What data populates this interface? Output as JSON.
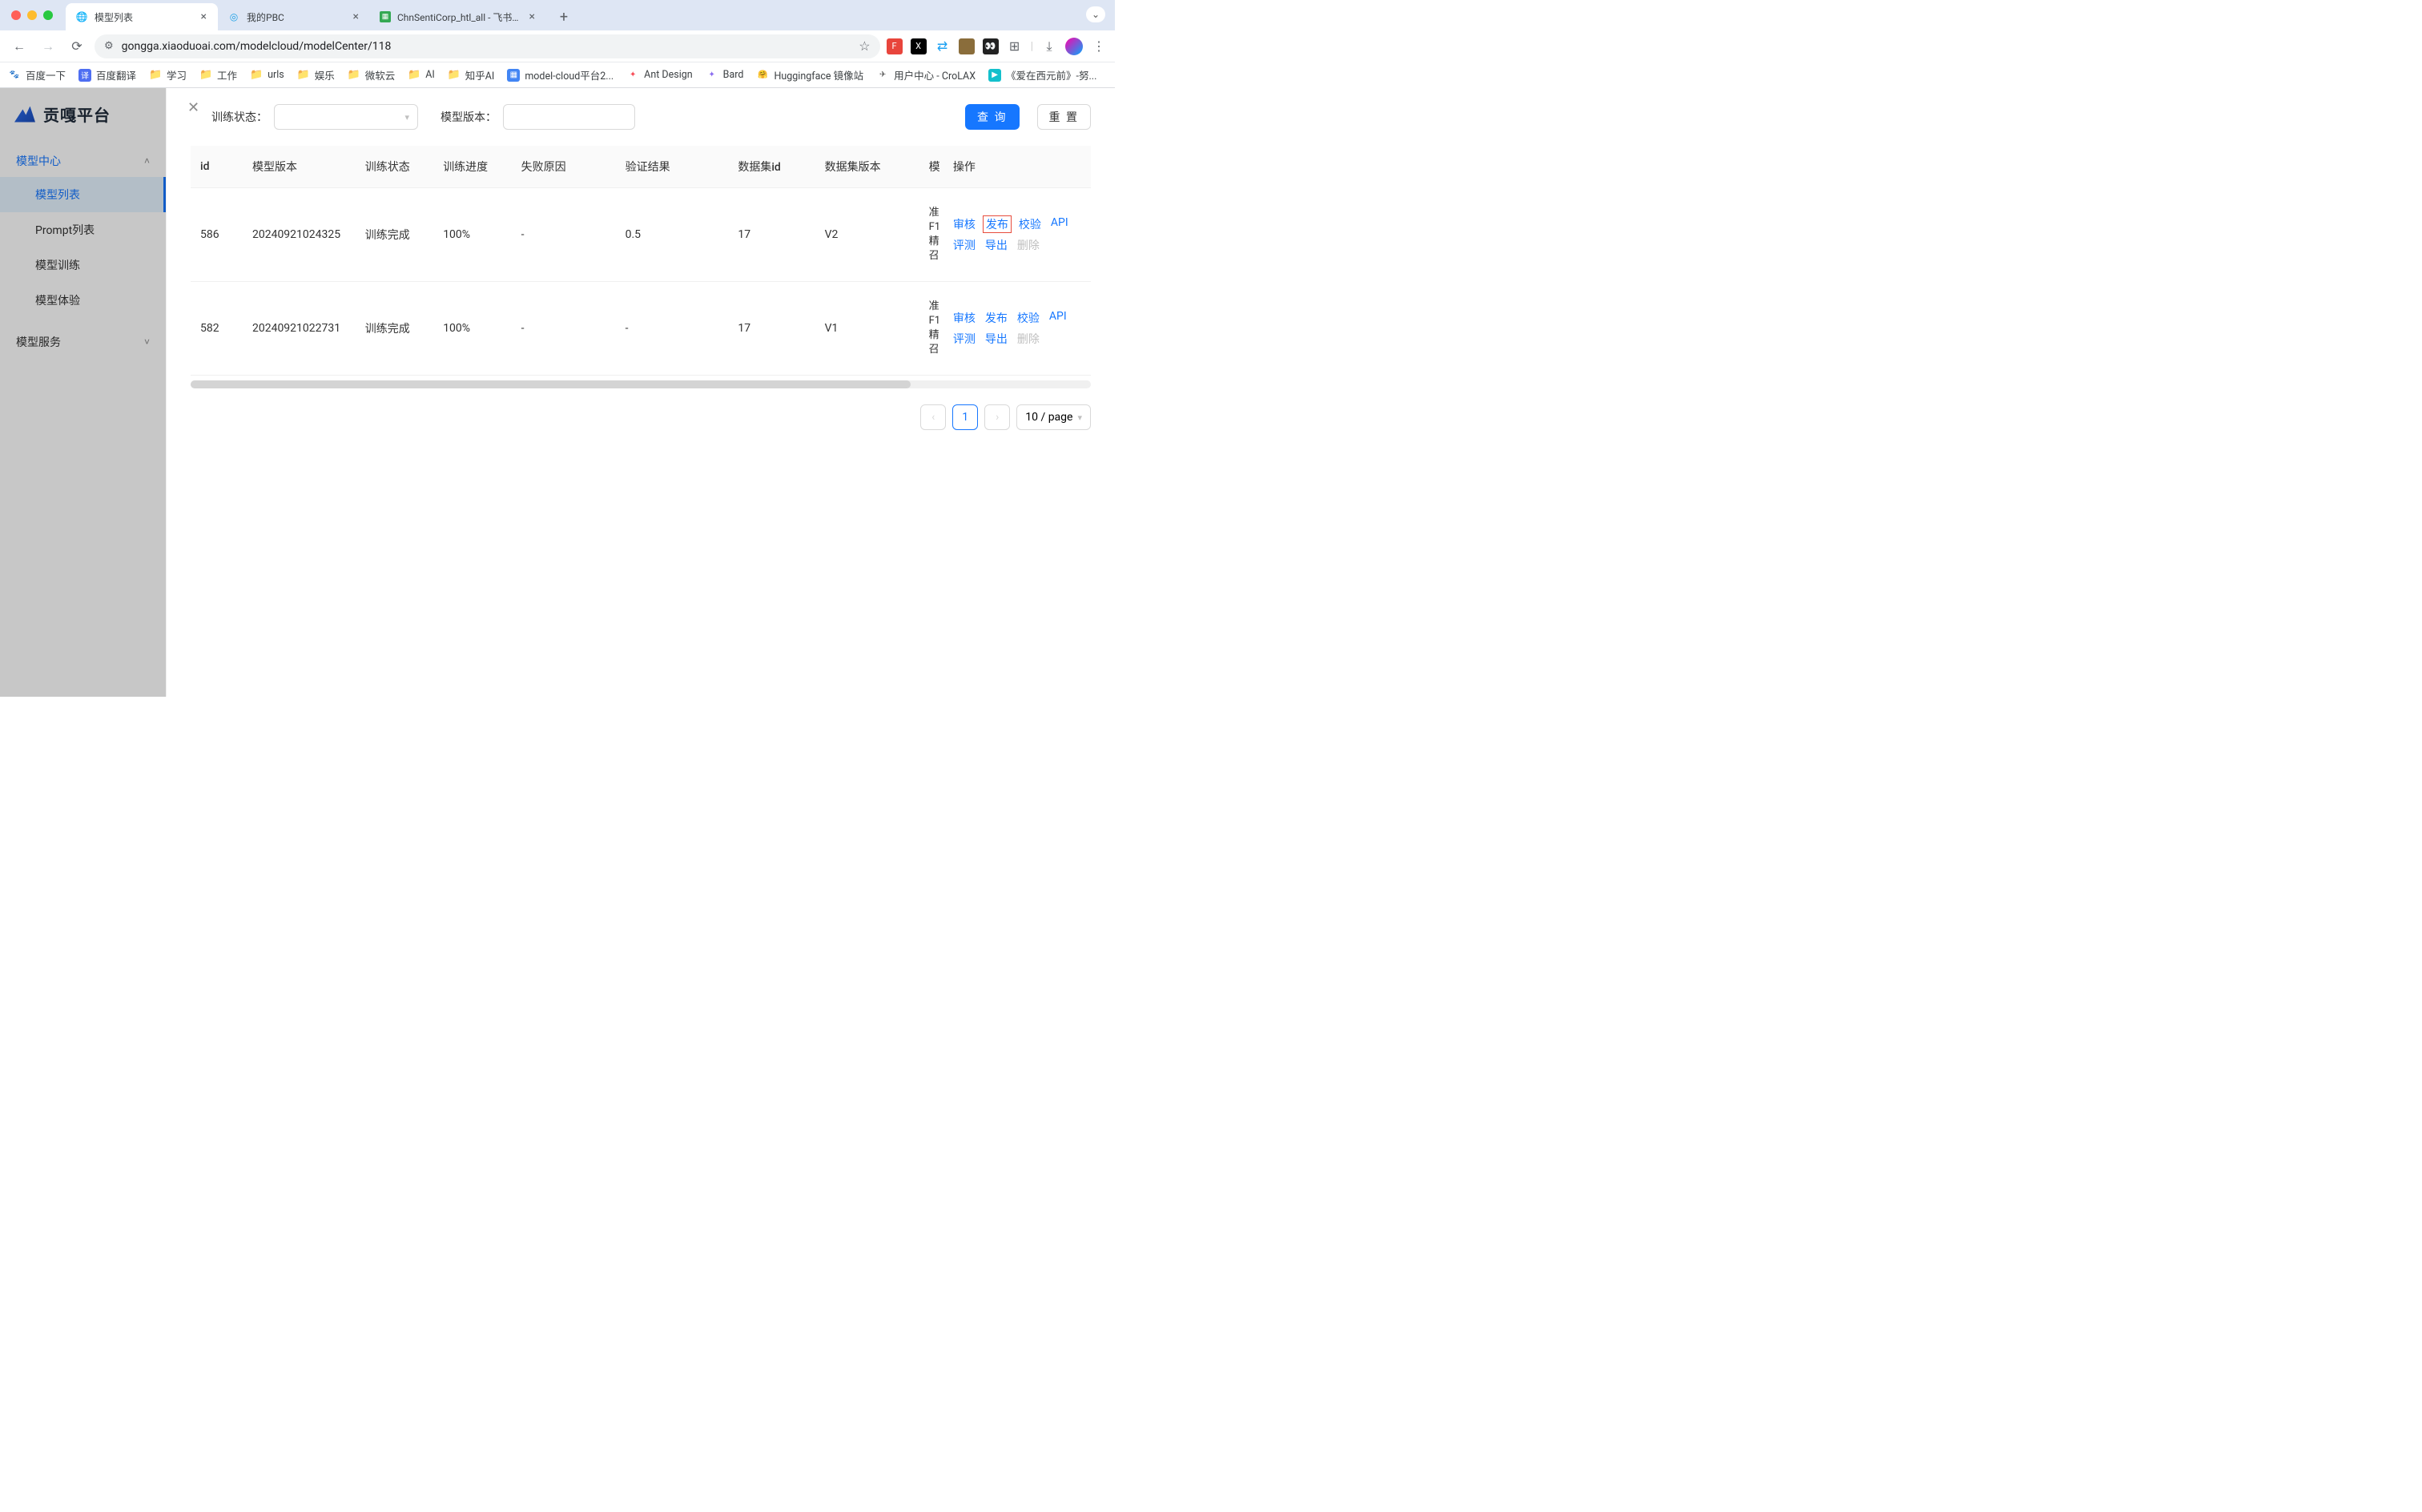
{
  "browser": {
    "tabs": [
      {
        "title": "模型列表",
        "favicon": "🌐",
        "active": true
      },
      {
        "title": "我的PBC",
        "favicon": "📘",
        "active": false
      },
      {
        "title": "ChnSentiCorp_htl_all - 飞书云",
        "favicon": "📊",
        "active": false
      }
    ],
    "url": "gongga.xiaoduoai.com/modelcloud/modelCenter/118",
    "bookmarks": [
      {
        "label": "百度一下",
        "icon": "paw",
        "color": "#2932e1"
      },
      {
        "label": "百度翻译",
        "icon": "译",
        "color": "#4e6ef2"
      },
      {
        "label": "学习",
        "icon": "folder"
      },
      {
        "label": "工作",
        "icon": "folder"
      },
      {
        "label": "urls",
        "icon": "folder"
      },
      {
        "label": "娱乐",
        "icon": "folder"
      },
      {
        "label": "微软云",
        "icon": "folder"
      },
      {
        "label": "AI",
        "icon": "folder"
      },
      {
        "label": "知乎AI",
        "icon": "folder"
      },
      {
        "label": "model-cloud平台2...",
        "icon": "doc",
        "color": "#4285f4"
      },
      {
        "label": "Ant Design",
        "icon": "ant",
        "color": "#f74c57"
      },
      {
        "label": "Bard",
        "icon": "spark",
        "color": "#8a6cf0"
      },
      {
        "label": "Huggingface 镜像站",
        "icon": "hf",
        "color": "#ffcc33"
      },
      {
        "label": "用户中心 - CroLAX",
        "icon": "rocket",
        "color": "#555"
      },
      {
        "label": "《爱在西元前》-努...",
        "icon": "tv",
        "color": "#14c0cc"
      }
    ]
  },
  "sidebar": {
    "brand": "贡嘎平台",
    "menu1": {
      "label": "模型中心",
      "expanded": true,
      "items": [
        "模型列表",
        "Prompt列表",
        "模型训练",
        "模型体验"
      ],
      "activeIndex": 0
    },
    "menu2": {
      "label": "模型服务",
      "expanded": false
    }
  },
  "filters": {
    "status_label": "训练状态：",
    "version_label": "模型版本：",
    "query_btn": "查 询",
    "reset_btn": "重 置"
  },
  "table": {
    "columns": [
      "id",
      "模型版本",
      "训练状态",
      "训练进度",
      "失败原因",
      "验证结果",
      "数据集id",
      "数据集版本",
      "模",
      "操作"
    ],
    "model_col_lines": [
      "准",
      "F1",
      "精",
      "召"
    ],
    "rows": [
      {
        "id": "586",
        "version": "20240921024325",
        "status": "训练完成",
        "progress": "100%",
        "fail": "-",
        "verify": "0.5",
        "dataset_id": "17",
        "dataset_ver": "V2",
        "highlight_publish": true
      },
      {
        "id": "582",
        "version": "20240921022731",
        "status": "训练完成",
        "progress": "100%",
        "fail": "-",
        "verify": "-",
        "dataset_id": "17",
        "dataset_ver": "V1",
        "highlight_publish": false
      }
    ],
    "actions": {
      "audit": "审核",
      "publish": "发布",
      "verify": "校验",
      "api": "API",
      "eval": "评测",
      "export": "导出",
      "delete": "删除"
    }
  },
  "pagination": {
    "current": "1",
    "page_size_label": "10 / page"
  }
}
